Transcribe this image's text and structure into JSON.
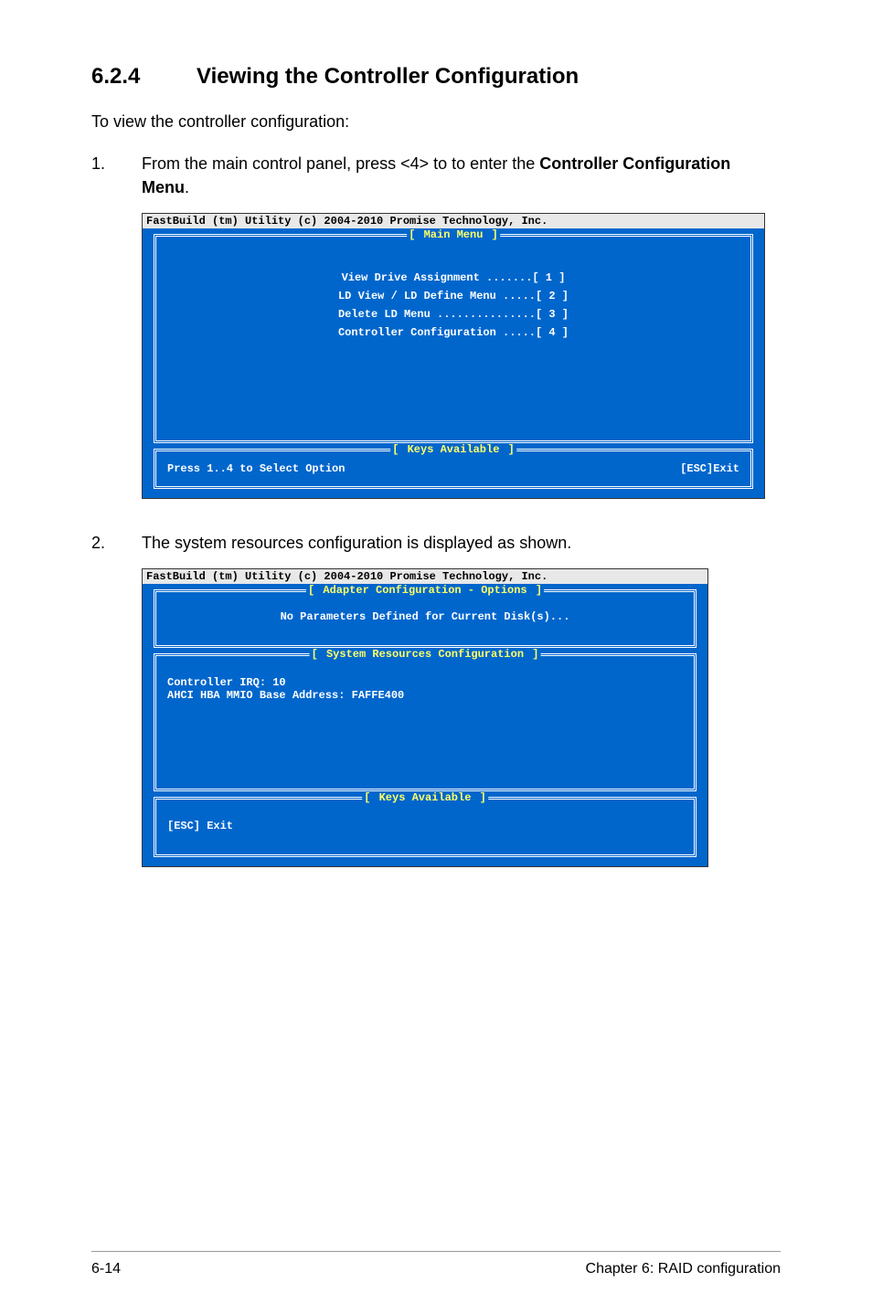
{
  "heading": {
    "number": "6.2.4",
    "title": "Viewing the Controller Configuration"
  },
  "intro": "To view the controller configuration:",
  "step1": {
    "number": "1.",
    "text_before": "From the main control panel, press <4> to to enter the ",
    "bold": "Controller Configuration Menu",
    "text_after": "."
  },
  "screenshot1": {
    "header": "FastBuild (tm) Utility (c) 2004-2010 Promise Technology, Inc.",
    "main_menu_title": " Main Menu ",
    "menu_items": {
      "line1": "View Drive Assignment .......[ 1 ]",
      "line2": "LD View / LD Define Menu .....[ 2 ]",
      "line3": "Delete LD Menu ...............[ 3 ]",
      "line4": "Controller Configuration .....[ 4 ]"
    },
    "keys_title": " Keys Available ",
    "keys_left": "Press 1..4 to Select Option",
    "keys_right": "[ESC]Exit"
  },
  "step2": {
    "number": "2.",
    "text": "The system resources configuration is displayed as shown."
  },
  "screenshot2": {
    "header": "FastBuild (tm) Utility (c) 2004-2010 Promise Technology, Inc.",
    "adapter_title": " Adapter Configuration - Options ",
    "adapter_content": "No Parameters Defined for Current Disk(s)...",
    "sysres_title": " System Resources Configuration ",
    "sysres_line1": "Controller IRQ: 10",
    "sysres_line2": "AHCI HBA MMIO Base Address: FAFFE400",
    "keys_title": " Keys Available ",
    "keys_content": "[ESC] Exit"
  },
  "footer": {
    "left": "6-14",
    "right": "Chapter 6: RAID configuration"
  }
}
